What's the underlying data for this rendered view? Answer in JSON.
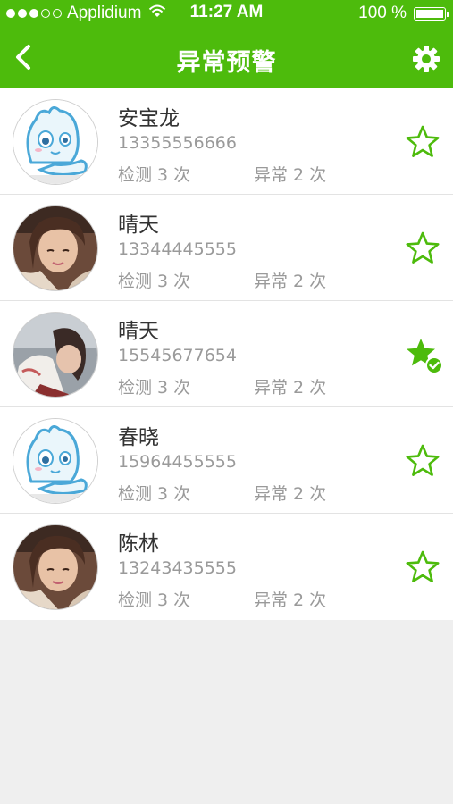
{
  "status": {
    "carrier": "Applidium",
    "time": "11:27 AM",
    "battery": "100 %"
  },
  "nav": {
    "title": "异常预警"
  },
  "colors": {
    "accent": "#4dbb0c"
  },
  "contacts": [
    {
      "name": "安宝龙",
      "phone": "13355556666",
      "checks": "检测 3 次",
      "anomalies": "异常 2 次",
      "avatar": "cartoon-avatar",
      "starred": false
    },
    {
      "name": "晴天",
      "phone": "13344445555",
      "checks": "检测 3 次",
      "anomalies": "异常 2 次",
      "avatar": "photo-avatar-girl",
      "starred": false
    },
    {
      "name": "晴天",
      "phone": "15545677654",
      "checks": "检测 3 次",
      "anomalies": "异常 2 次",
      "avatar": "photo-avatar-girl-2",
      "starred": true
    },
    {
      "name": "春晓",
      "phone": "15964455555",
      "checks": "检测 3 次",
      "anomalies": "异常 2 次",
      "avatar": "cartoon-avatar",
      "starred": false
    },
    {
      "name": "陈林",
      "phone": "13243435555",
      "checks": "检测 3 次",
      "anomalies": "异常 2 次",
      "avatar": "photo-avatar-girl",
      "starred": false
    }
  ]
}
